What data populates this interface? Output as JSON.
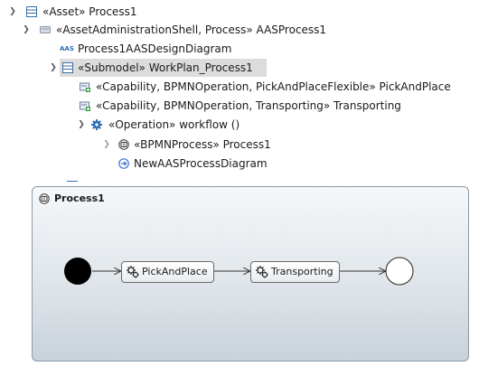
{
  "tree": {
    "root": {
      "label": "«Asset» Process1"
    },
    "shell": {
      "label": "«AssetAdministrationShell, Process» AASProcess1"
    },
    "design_diagram": {
      "icon_text": "AAS",
      "label": "Process1AASDesignDiagram"
    },
    "submodel": {
      "label": "«Submodel» WorkPlan_Process1"
    },
    "capability_pick": {
      "label": "«Capability, BPMNOperation, PickAndPlaceFlexible» PickAndPlace"
    },
    "capability_transport": {
      "label": "«Capability, BPMNOperation, Transporting» Transporting"
    },
    "operation": {
      "label": "«Operation» workflow ()"
    },
    "bpmn_process": {
      "label": "«BPMNProcess» Process1"
    },
    "process_diagram": {
      "label": "NewAASProcessDiagram"
    }
  },
  "diagram": {
    "title": "Process1",
    "tasks": [
      {
        "label": "PickAndPlace"
      },
      {
        "label": "Transporting"
      }
    ]
  },
  "colors": {
    "selection": "#dcdcdc",
    "submodel_icon": "#3b6ea8",
    "capability_icon_green": "#2e9e3e",
    "operation_icon": "#2f6db5",
    "diagram_icon": "#3a6fd1"
  }
}
